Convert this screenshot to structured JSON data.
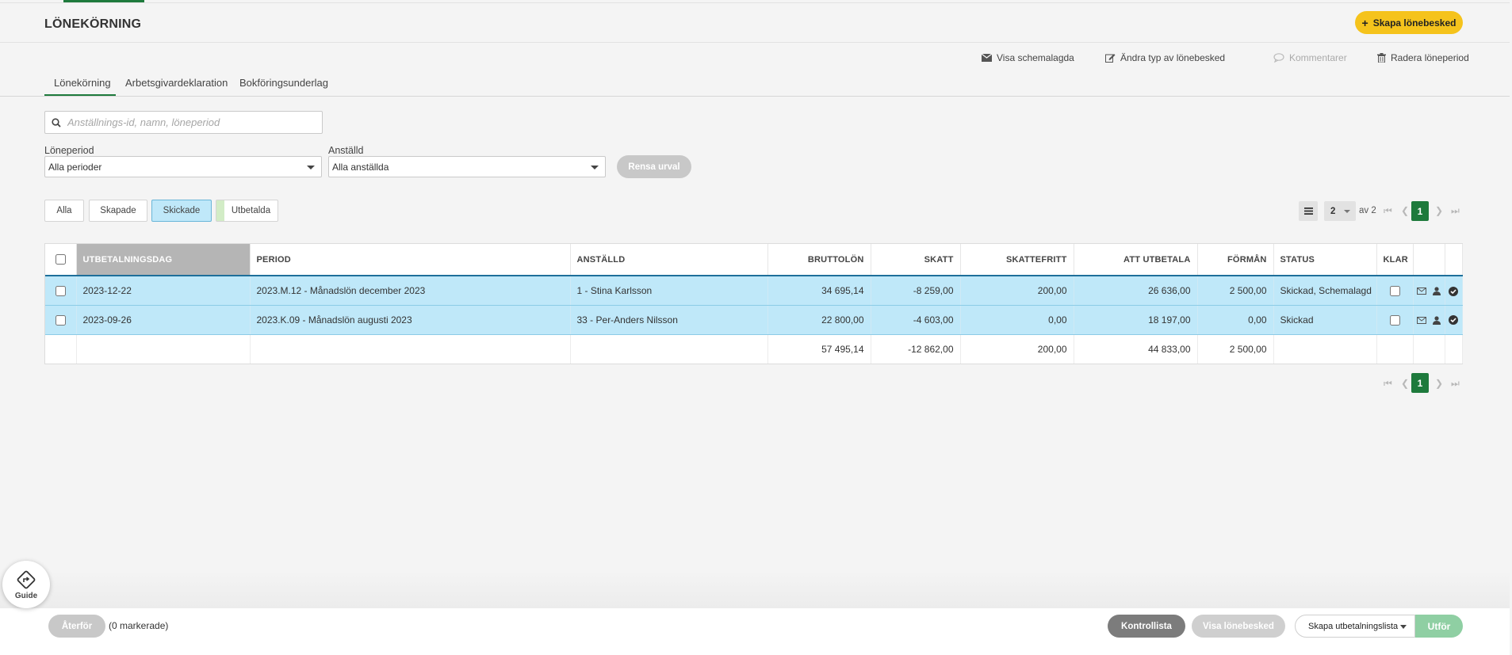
{
  "page": {
    "title": "LÖNEKÖRNING"
  },
  "header": {
    "create_button": "Skapa lönebesked"
  },
  "actions": {
    "show_scheduled": "Visa schemalagda",
    "change_type": "Ändra typ av lönebesked",
    "comment": "Kommentarer",
    "delete_period": "Radera löneperiod"
  },
  "tabs": [
    "Lönekörning",
    "Arbetsgivardeklaration",
    "Bokföringsunderlag"
  ],
  "search": {
    "placeholder": "Anställnings-id, namn, löneperiod"
  },
  "filters": {
    "period_label": "Löneperiod",
    "period_value": "Alla perioder",
    "employee_label": "Anställd",
    "employee_value": "Alla anställda",
    "clear_button": "Rensa urval"
  },
  "status_filters": [
    "Alla",
    "Skapade",
    "Skickade",
    "Utbetalda"
  ],
  "pager": {
    "page_size": "2",
    "of_text": "av 2",
    "current_page": "1"
  },
  "table": {
    "columns": [
      "Utbetalningsdag",
      "Period",
      "Anställd",
      "Bruttolön",
      "Skatt",
      "Skattefritt",
      "Att utbetala",
      "Förmån",
      "Status",
      "Klar"
    ],
    "rows": [
      {
        "date": "2023-12-22",
        "period": "2023.M.12 - Månadslön december 2023",
        "employee": "1 - Stina Karlsson",
        "gross": "34 695,14",
        "tax": "-8 259,00",
        "taxfree": "200,00",
        "payout": "26 636,00",
        "benefit": "2 500,00",
        "status": "Skickad, Schemalagd"
      },
      {
        "date": "2023-09-26",
        "period": "2023.K.09 - Månadslön augusti 2023",
        "employee": "33 - Per-Anders Nilsson",
        "gross": "22 800,00",
        "tax": "-4 603,00",
        "taxfree": "0,00",
        "payout": "18 197,00",
        "benefit": "0,00",
        "status": "Skickad"
      }
    ],
    "totals": {
      "gross": "57 495,14",
      "tax": "-12 862,00",
      "taxfree": "200,00",
      "payout": "44 833,00",
      "benefit": "2 500,00"
    }
  },
  "bottom": {
    "guide": "Guide",
    "undo": "Återför",
    "marked": "(0 markerade)",
    "checklist": "Kontrollista",
    "show_payslip": "Visa lönebesked",
    "payout_list": "Skapa utbetalningslista",
    "run": "Utför"
  },
  "colors": {
    "accent": "#1e7a3c",
    "brand_yellow": "#f5c31c",
    "row_selected": "#bfe8f9"
  }
}
